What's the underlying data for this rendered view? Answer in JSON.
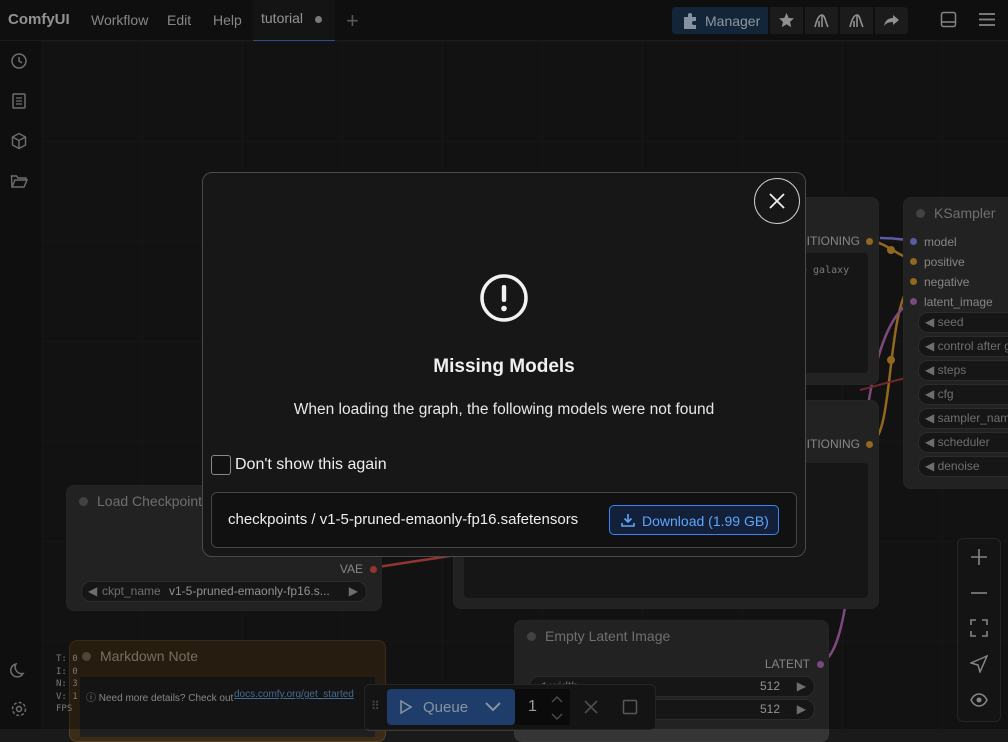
{
  "topbar": {
    "brand": "ComfyUI",
    "menu": [
      "Workflow",
      "Edit",
      "Help"
    ],
    "tab_label": "tutorial",
    "manager_label": "Manager"
  },
  "nodes": {
    "ksampler": {
      "title": "KSampler",
      "inputs": [
        "model",
        "positive",
        "negative",
        "latent_image"
      ],
      "widgets": [
        "seed",
        "control after g",
        "steps",
        "cfg",
        "sampler_nam",
        "scheduler",
        "denoise"
      ]
    },
    "conditioning_top": {
      "output": "ITIONING",
      "text_fragment": "e galaxy"
    },
    "conditioning_bottom": {
      "output": "ITIONING"
    },
    "load_checkpoint": {
      "title": "Load Checkpoint",
      "output": "VAE",
      "widget_label": "ckpt_name",
      "widget_value": "v1-5-pruned-emaonly-fp16.s..."
    },
    "empty_latent": {
      "title": "Empty Latent Image",
      "output": "LATENT",
      "widget_label": "width",
      "values": [
        "512",
        "512"
      ]
    },
    "markdown_note": {
      "title": "Markdown Note",
      "text": "ⓘ Need more details? Check out",
      "link": "docs.comfy.org/get_started"
    }
  },
  "stats": [
    "T: 0",
    "I: 0",
    "N: 3",
    "V: 1",
    "FPS"
  ],
  "dialog": {
    "title": "Missing Models",
    "message": "When loading the graph, the following models were not found",
    "checkbox_label": "Don't show this again",
    "model_name": "checkpoints / v1-5-pruned-emaonly-fp16.safetensors",
    "download_label": "Download (1.99 GB)"
  },
  "queue": {
    "label": "Queue",
    "count": "1"
  },
  "colors": {
    "accent": "#3b82f6",
    "queue_button": "#2f5fa3",
    "manager_bg": "#1e3a56",
    "model_dot": "#8a8aff",
    "conditioning_dot": "#e0a030",
    "latent_dot": "#c070c0",
    "vae_dot": "#e05050"
  }
}
